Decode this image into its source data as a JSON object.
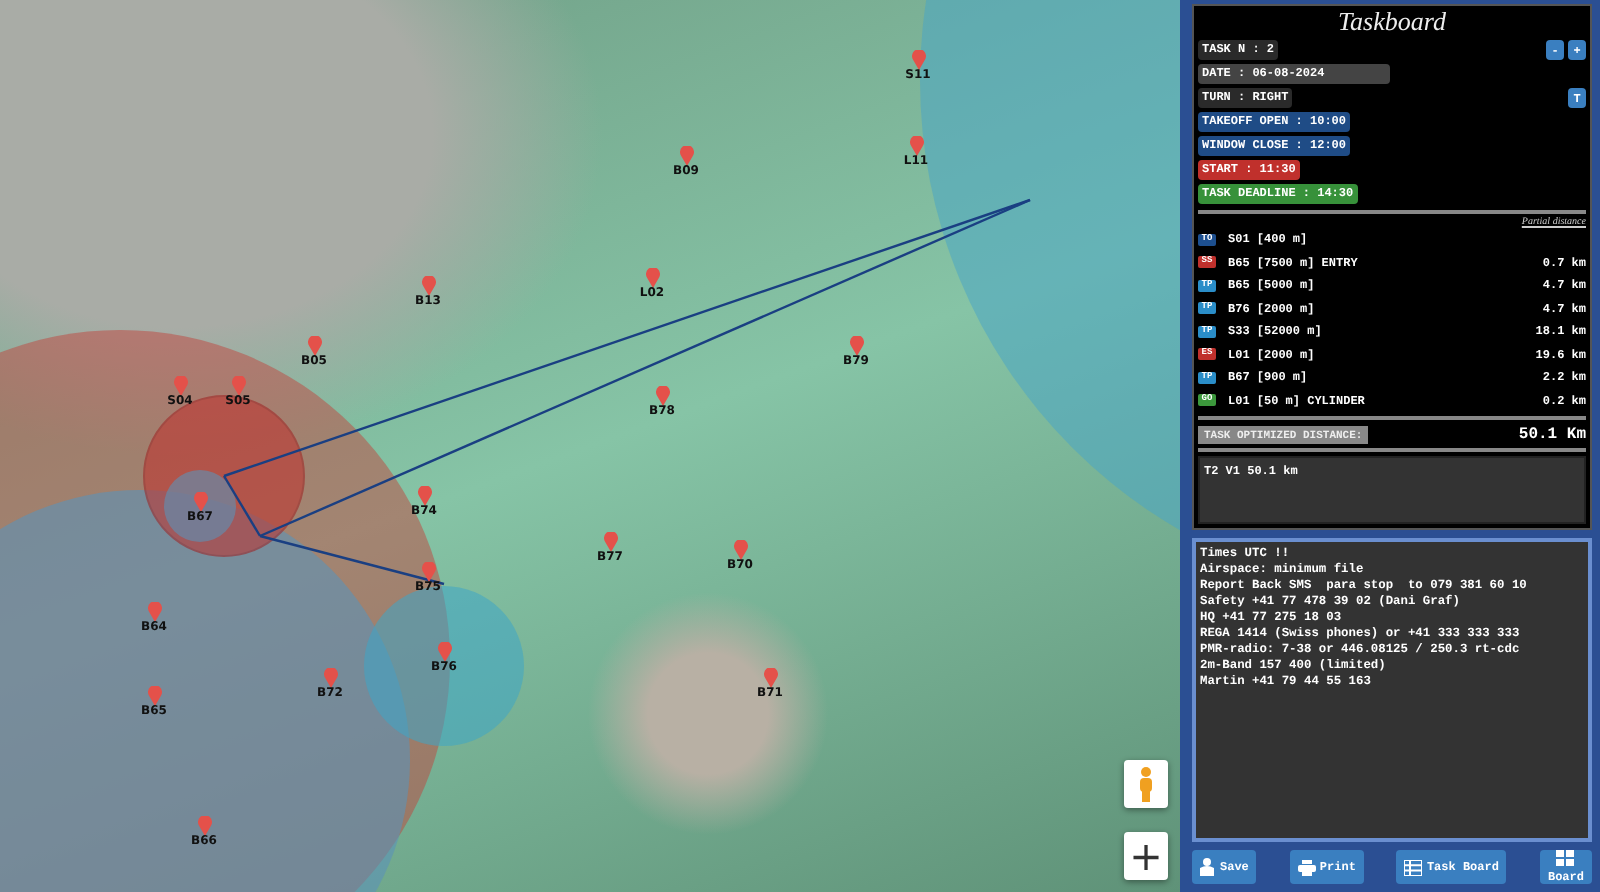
{
  "map": {
    "waypoints": [
      {
        "label": "S11"
      },
      {
        "label": "B09"
      },
      {
        "label": "L11"
      },
      {
        "label": "B13"
      },
      {
        "label": "L02"
      },
      {
        "label": "B79"
      },
      {
        "label": "B78"
      },
      {
        "label": "S04"
      },
      {
        "label": "S05"
      },
      {
        "label": "B05"
      },
      {
        "label": "B74"
      },
      {
        "label": "B77"
      },
      {
        "label": "B70"
      },
      {
        "label": "B75"
      },
      {
        "label": "B76"
      },
      {
        "label": "B67"
      },
      {
        "label": "B64"
      },
      {
        "label": "B65"
      },
      {
        "label": "B72"
      },
      {
        "label": "B71"
      },
      {
        "label": "B66"
      }
    ],
    "zoom_in": "+"
  },
  "taskboard": {
    "title": "Taskboard",
    "fields": [
      {
        "kind": "plain",
        "text": "TASK N : 2",
        "buttons": [
          "-",
          "+"
        ]
      },
      {
        "kind": "input",
        "text": "DATE : 06-08-2024"
      },
      {
        "kind": "plain",
        "text": "TURN : RIGHT",
        "buttons": [
          "T"
        ]
      },
      {
        "kind": "time",
        "text": "TAKEOFF OPEN : 10:00"
      },
      {
        "kind": "time",
        "text": "WINDOW CLOSE : 12:00"
      },
      {
        "kind": "start",
        "text": "START : 11:30"
      },
      {
        "kind": "deadline",
        "text": "TASK DEADLINE : 14:30"
      }
    ],
    "partial_distance_label": "Partial distance",
    "turnpoints": [
      {
        "type": "TO",
        "name": "S01 [400 m]"
      },
      {
        "type": "SS",
        "name": "B65 [7500 m] ENTRY",
        "distance": "0.7 km"
      },
      {
        "type": "TP",
        "name": "B65 [5000 m]",
        "distance": "4.7 km"
      },
      {
        "type": "TP",
        "name": "B76 [2000 m]",
        "distance": "4.7 km"
      },
      {
        "type": "TP",
        "name": "S33 [52000 m]",
        "distance": "18.1 km"
      },
      {
        "type": "ES",
        "name": "L01 [2000 m]",
        "distance": "19.6 km"
      },
      {
        "type": "TP",
        "name": "B67 [900 m]",
        "distance": "2.2 km"
      },
      {
        "type": "GO",
        "name": "L01 [50 m] CYLINDER",
        "distance": "0.2 km"
      }
    ],
    "optimized_distance": {
      "label": "TASK OPTIMIZED DISTANCE:",
      "value": "50.1 Km"
    },
    "summary": "T2 V1 50.1 km",
    "notes": [
      "Times UTC !!",
      "Airspace: minimum file",
      "Report Back SMS  para stop  to 079 381 60 10",
      "Safety +41 77 478 39 02 (Dani Graf)",
      "HQ +41 77 275 18 03",
      "REGA 1414 (Swiss phones) or +41 333 333 333",
      "PMR-radio: 7-38 or 446.08125 / 250.3 rt-cdc",
      "2m-Band 157 400 (limited)",
      "Martin +41 79 44 55 163"
    ],
    "buttons": [
      {
        "kind": "save",
        "label": "Save"
      },
      {
        "kind": "print",
        "label": "Print"
      },
      {
        "kind": "taskboard",
        "label": "Task Board"
      },
      {
        "kind": "board",
        "label": "Board"
      }
    ]
  }
}
